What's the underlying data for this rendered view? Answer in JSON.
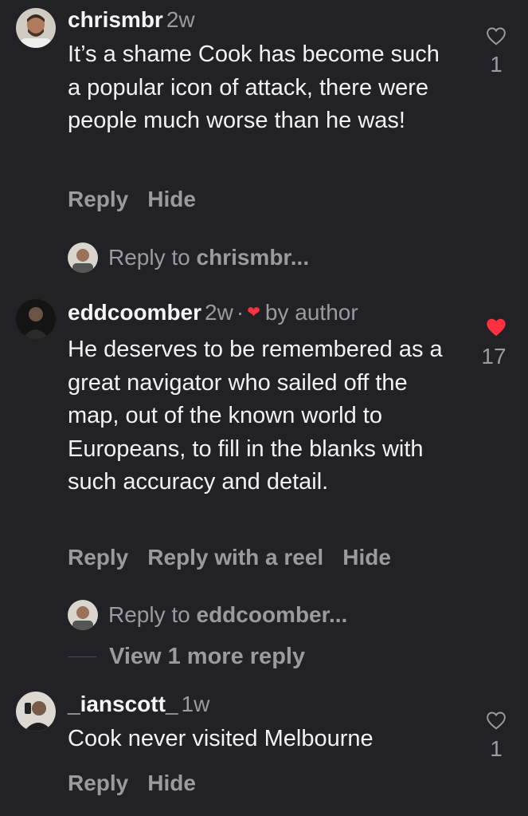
{
  "comments": [
    {
      "username": "chrismbr",
      "time": "2w",
      "text": "It’s a shame Cook has become such a popular icon of attack, there were people much worse than he was!",
      "actions": [
        "Reply",
        "Hide"
      ],
      "likes": "1",
      "liked": false
    },
    {
      "username": "eddcoomber",
      "time": "2w",
      "separator": "·",
      "by_author": "by author",
      "text": "He deserves to be remembered as a great navigator who sailed off the map, out of the known world to Europeans, to fill in the blanks with such accuracy and detail.",
      "actions": [
        "Reply",
        "Reply with a reel",
        "Hide"
      ],
      "likes": "17",
      "liked": true
    },
    {
      "username": "_ianscott_",
      "time": "1w",
      "text": "Cook never visited Melbourne",
      "actions": [
        "Reply",
        "Hide"
      ],
      "likes": "1",
      "liked": false
    }
  ],
  "reply_prompts": [
    {
      "prefix": "Reply to ",
      "name": "chrismbr..."
    },
    {
      "prefix": "Reply to ",
      "name": "eddcoomber..."
    }
  ],
  "view_more": "View 1 more reply",
  "colors": {
    "background": "#222226",
    "text": "#f2f2f2",
    "muted": "#9a9a9f",
    "like_red": "#ff3040"
  },
  "icons": [
    "heart-outline-icon",
    "heart-filled-icon",
    "small-heart-icon"
  ]
}
